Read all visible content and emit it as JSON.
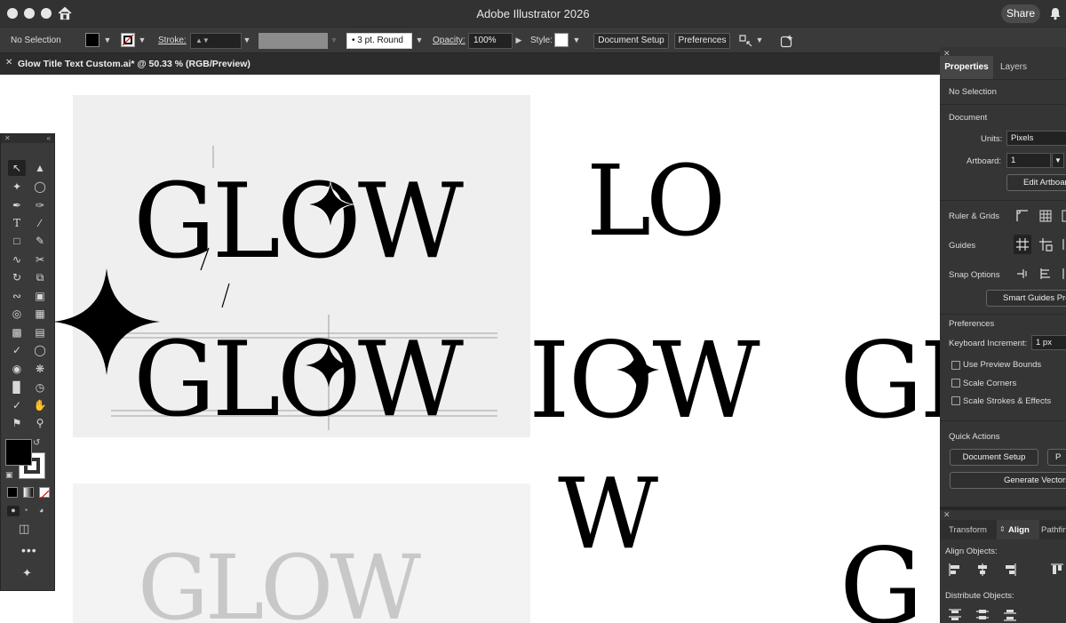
{
  "app": {
    "title": "Adobe Illustrator 2026",
    "share": "Share"
  },
  "control_bar": {
    "selection": "No Selection",
    "stroke_label": "Stroke:",
    "brush": "3 pt. Round",
    "opacity_label": "Opacity:",
    "opacity_value": "100%",
    "style_label": "Style:",
    "document_setup": "Document Setup",
    "preferences": "Preferences"
  },
  "document_tab": {
    "name": "Glow Title Text Custom.ai* @ 50.33 % (RGB/Preview)"
  },
  "properties_panel": {
    "tabs": [
      "Properties",
      "Layers"
    ],
    "selection": "No Selection",
    "document_heading": "Document",
    "units_label": "Units:",
    "units_value": "Pixels",
    "artboard_label": "Artboard:",
    "artboard_value": "1",
    "edit_artboards": "Edit Artboards",
    "ruler_grids": "Ruler & Grids",
    "guides": "Guides",
    "snap_options": "Snap Options",
    "smart_guides": "Smart Guides Preferences",
    "preferences_heading": "Preferences",
    "keyboard_increment_label": "Keyboard Increment:",
    "keyboard_increment_value": "1 px",
    "checkboxes": [
      "Use Preview Bounds",
      "Scale Corners",
      "Scale Strokes & Effects"
    ],
    "quick_actions_heading": "Quick Actions",
    "document_setup": "Document Setup",
    "preferences_short": "P",
    "generate_vectors": "Generate Vectors"
  },
  "align_panel": {
    "tabs": [
      "Transform",
      "Align",
      "Pathfinder"
    ],
    "align_objects": "Align Objects:",
    "distribute_objects": "Distribute Objects:"
  },
  "canvas": {
    "sketch_text_1": "GLOW",
    "sketch_text_2": "GLOW",
    "sketch_text_3": "GLOW",
    "glyphs_row1": "LO",
    "glyphs_row2": "IOW",
    "glyphs_row3": "W",
    "glyphs_right_1": "GL",
    "glyphs_right_2": "G"
  },
  "colors": {
    "chrome_dark": "#323232",
    "panel": "#353535",
    "fill_swatch": "#000000",
    "stroke_preview": "#8c8c8c"
  }
}
